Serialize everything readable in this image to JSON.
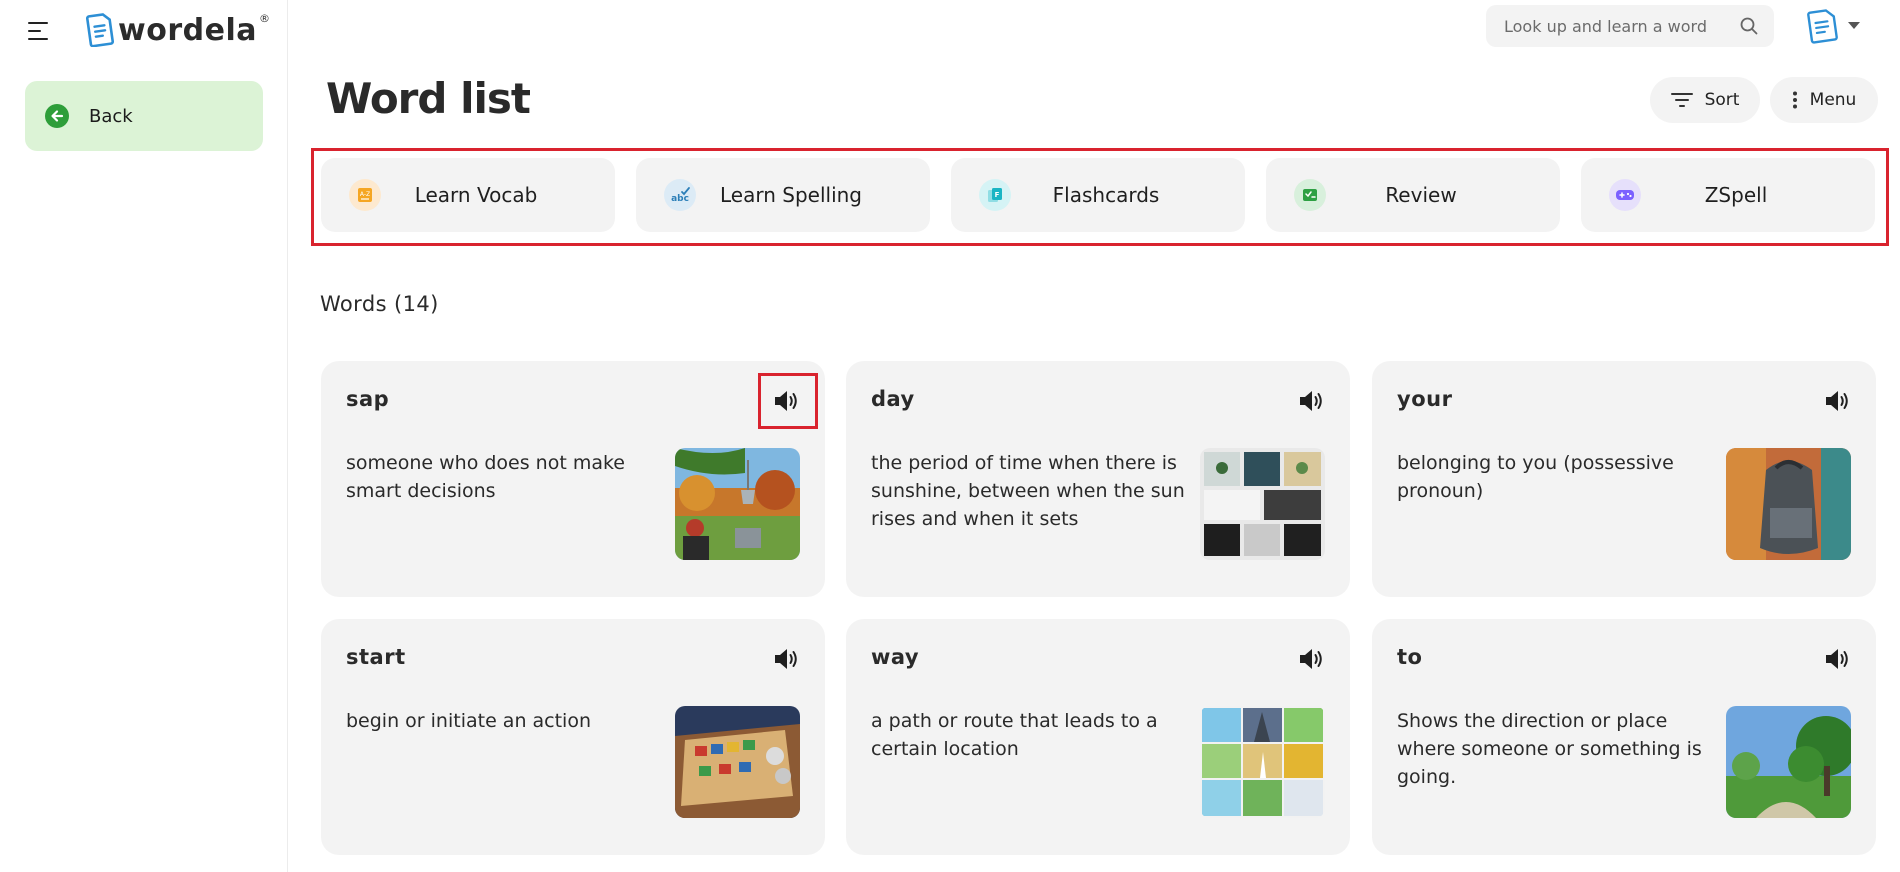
{
  "brand": {
    "name": "wordela",
    "reg": "®"
  },
  "sidebar": {
    "back_label": "Back"
  },
  "search": {
    "placeholder": "Look up and learn a word"
  },
  "page": {
    "title": "Word list",
    "sort_label": "Sort",
    "menu_label": "Menu"
  },
  "activities": [
    {
      "label": "Learn Vocab",
      "icon": "vocab-icon",
      "color": "#f5a623"
    },
    {
      "label": "Learn Spelling",
      "icon": "spelling-icon",
      "color": "#2c7fb8"
    },
    {
      "label": "Flashcards",
      "icon": "flashcards-icon",
      "color": "#19b5c4"
    },
    {
      "label": "Review",
      "icon": "review-icon",
      "color": "#2ea043"
    },
    {
      "label": "ZSpell",
      "icon": "gamepad-icon",
      "color": "#7b61ff"
    }
  ],
  "words": {
    "count_label": "Words (14)",
    "items": [
      {
        "word": "sap",
        "definition": "someone who does not make smart decisions"
      },
      {
        "word": "day",
        "definition": "the period of time when there is sunshine, between when the sun rises and when it sets"
      },
      {
        "word": "your",
        "definition": "belonging to you (possessive pronoun)"
      },
      {
        "word": "start",
        "definition": "begin or initiate an action"
      },
      {
        "word": "way",
        "definition": "a path or route that leads to a certain location"
      },
      {
        "word": "to",
        "definition": "Shows the direction or place where someone or something is going."
      }
    ]
  },
  "colors": {
    "accent_green": "#2e9e3a",
    "back_bg": "#dcf3d6",
    "highlight_red": "#d9232e",
    "card_bg": "#f3f3f3"
  }
}
